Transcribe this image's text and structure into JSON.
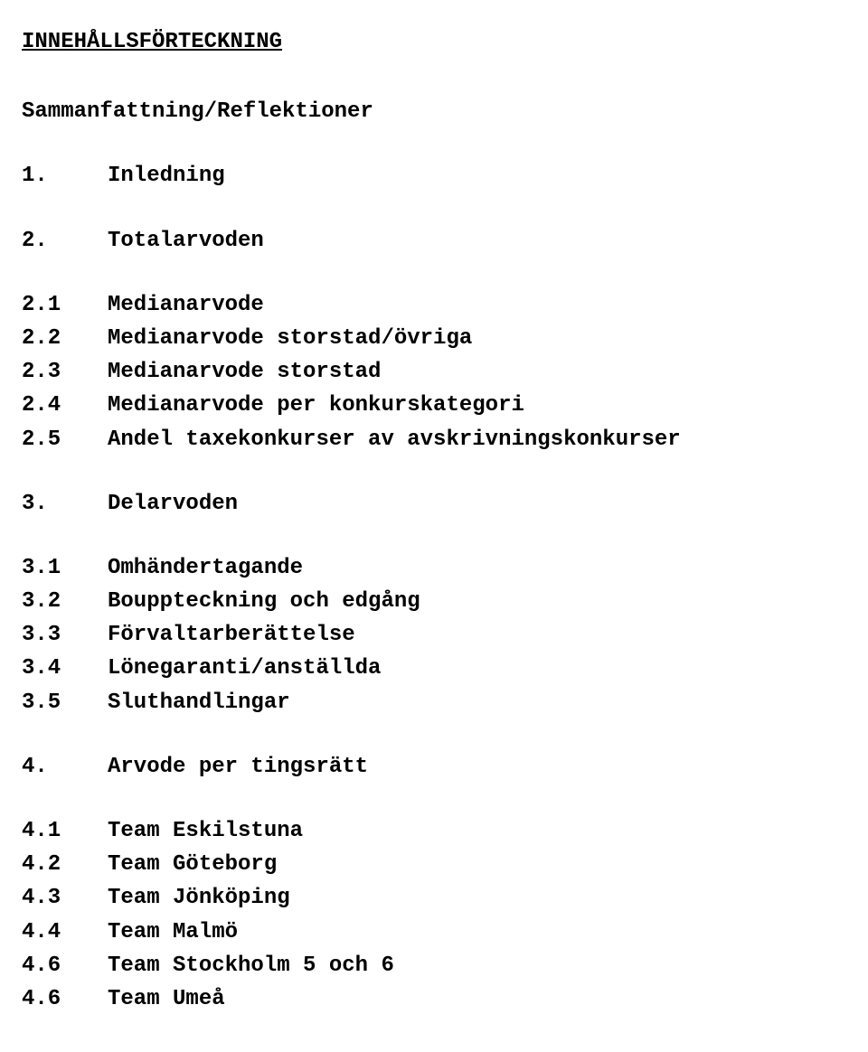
{
  "title": "INNEHÅLLSFÖRTECKNING",
  "subtitle": "Sammanfattning/Reflektioner",
  "groups": [
    {
      "items": [
        {
          "num": "1.",
          "text": "Inledning"
        }
      ]
    },
    {
      "items": [
        {
          "num": "2.",
          "text": "Totalarvoden"
        }
      ]
    },
    {
      "items": [
        {
          "num": "2.1",
          "text": "Medianarvode"
        },
        {
          "num": "2.2",
          "text": "Medianarvode storstad/övriga"
        },
        {
          "num": "2.3",
          "text": "Medianarvode storstad"
        },
        {
          "num": "2.4",
          "text": "Medianarvode per konkurskategori"
        },
        {
          "num": "2.5",
          "text": "Andel taxekonkurser av avskrivningskonkurser"
        }
      ]
    },
    {
      "items": [
        {
          "num": "3.",
          "text": "Delarvoden"
        }
      ]
    },
    {
      "items": [
        {
          "num": "3.1",
          "text": "Omhändertagande"
        },
        {
          "num": "3.2",
          "text": "Bouppteckning och edgång"
        },
        {
          "num": "3.3",
          "text": "Förvaltarberättelse"
        },
        {
          "num": "3.4",
          "text": "Lönegaranti/anställda"
        },
        {
          "num": "3.5",
          "text": "Sluthandlingar"
        }
      ]
    },
    {
      "items": [
        {
          "num": "4.",
          "text": "Arvode per tingsrätt"
        }
      ]
    },
    {
      "items": [
        {
          "num": "4.1",
          "text": "Team Eskilstuna"
        },
        {
          "num": "4.2",
          "text": "Team Göteborg"
        },
        {
          "num": "4.3",
          "text": "Team Jönköping"
        },
        {
          "num": "4.4",
          "text": "Team Malmö"
        },
        {
          "num": "4.6",
          "text": "Team Stockholm 5 och 6"
        },
        {
          "num": "4.6",
          "text": "Team Umeå"
        }
      ]
    }
  ]
}
